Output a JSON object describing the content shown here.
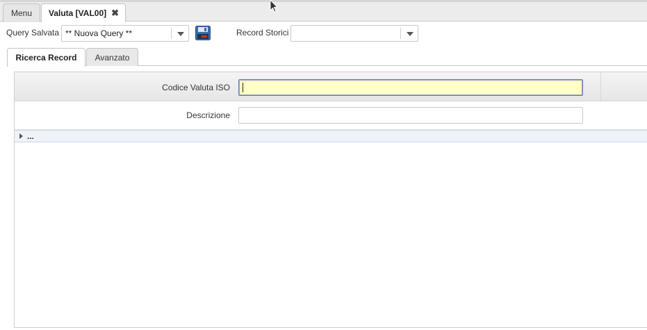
{
  "tabs": {
    "menu_label": "Menu",
    "active_label": "Valuta [VAL00]",
    "close_glyph": "✖"
  },
  "toolbar": {
    "query_salvata_label": "Query Salvata",
    "query_salvata_value": "** Nuova Query **",
    "record_storici_label": "Record Storici",
    "record_storici_value": ""
  },
  "subtabs": {
    "ricerca_label": "Ricerca Record",
    "avanzato_label": "Avanzato"
  },
  "form": {
    "codice_label": "Codice Valuta ISO",
    "codice_value": "",
    "descrizione_label": "Descrizione",
    "descrizione_value": ""
  },
  "expander": {
    "label": "..."
  },
  "icons": {
    "save": "floppy-disk-icon",
    "dropdown": "chevron-down-icon",
    "close": "close-icon",
    "expand": "triangle-right-icon"
  }
}
